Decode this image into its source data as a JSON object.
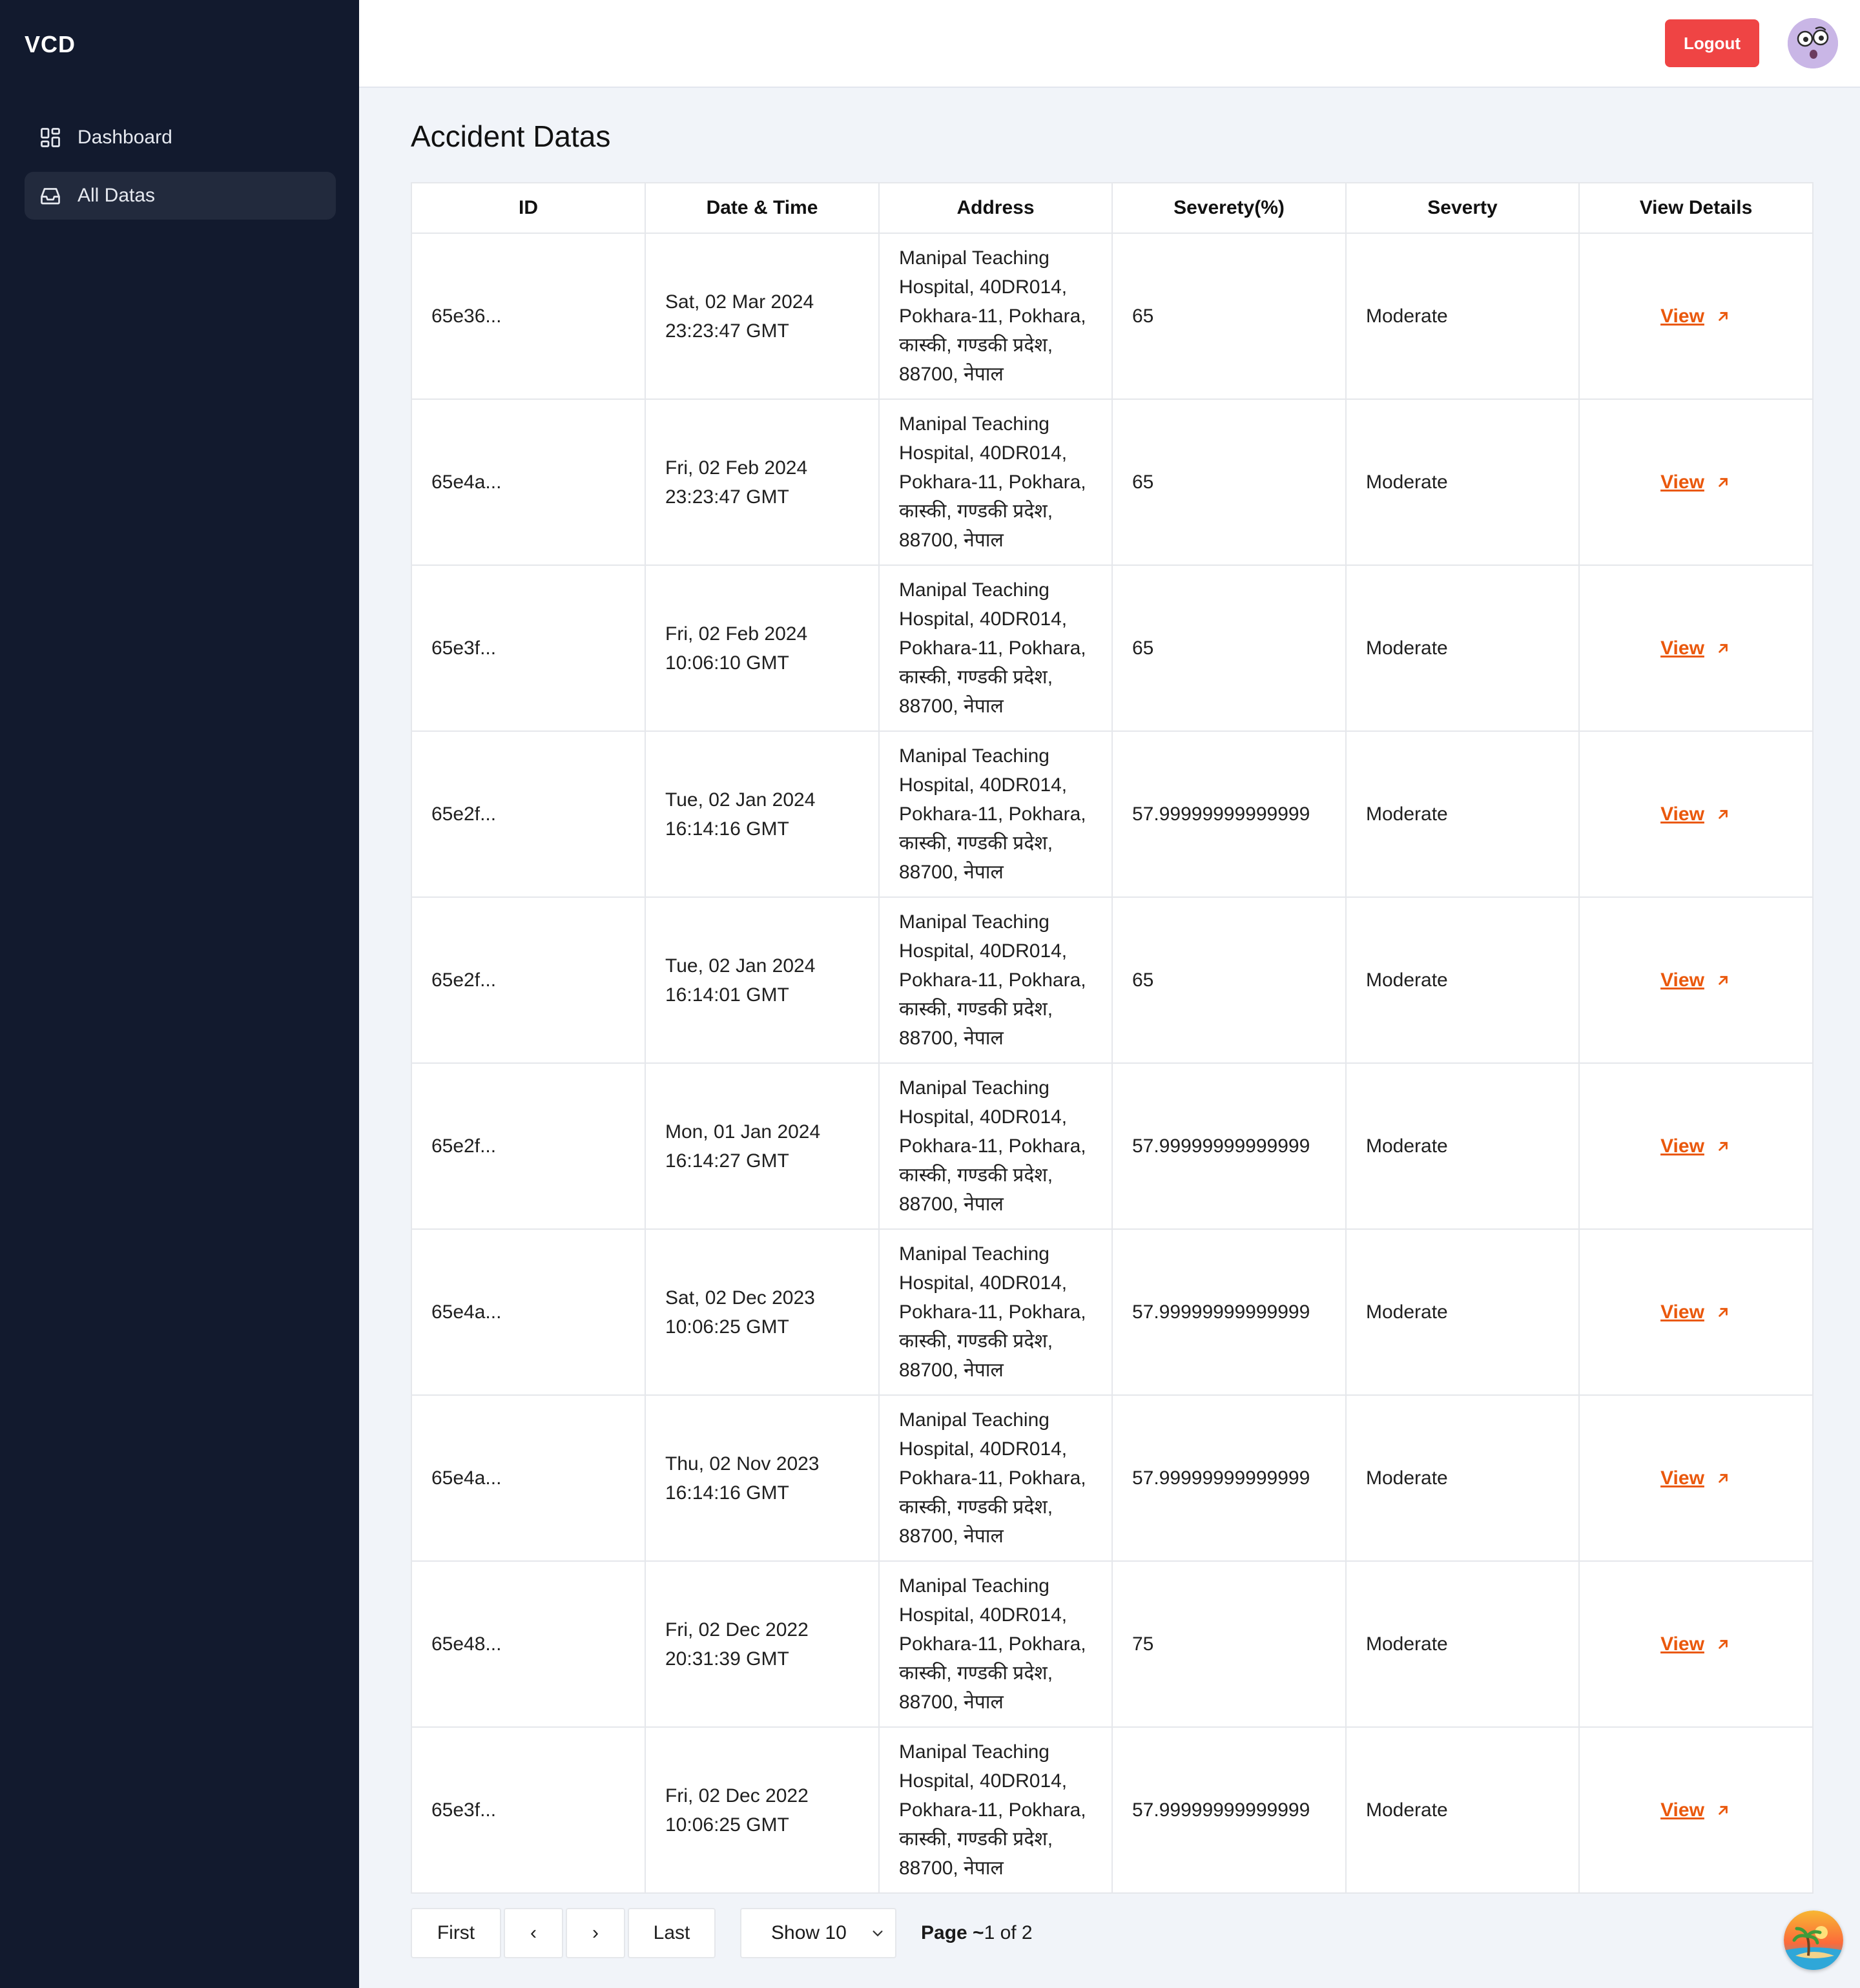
{
  "sidebar": {
    "brand": "VCD",
    "items": [
      {
        "label": "Dashboard",
        "icon": "dashboard-grid-icon",
        "active": false
      },
      {
        "label": "All Datas",
        "icon": "inbox-tray-icon",
        "active": true
      }
    ]
  },
  "topbar": {
    "logout_label": "Logout",
    "avatar_icon": "avatar-face-icon"
  },
  "main": {
    "title": "Accident Datas",
    "columns": [
      "ID",
      "Date & Time",
      "Address",
      "Severety(%)",
      "Severty",
      "View Details"
    ],
    "rows": [
      {
        "id": "65e36...",
        "date": "Sat, 02 Mar 2024",
        "time": "23:23:47 GMT",
        "address": [
          "Manipal Teaching",
          "Hospital, 40DR014,",
          "Pokhara-11, Pokhara,",
          "कास्की, गण्डकी प्रदेश,",
          "88700, नेपाल"
        ],
        "severity_pct": "65",
        "severity": "Moderate",
        "view": "View"
      },
      {
        "id": "65e4a...",
        "date": "Fri, 02 Feb 2024",
        "time": "23:23:47 GMT",
        "address": [
          "Manipal Teaching",
          "Hospital, 40DR014,",
          "Pokhara-11, Pokhara,",
          "कास्की, गण्डकी प्रदेश,",
          "88700, नेपाल"
        ],
        "severity_pct": "65",
        "severity": "Moderate",
        "view": "View"
      },
      {
        "id": "65e3f...",
        "date": "Fri, 02 Feb 2024",
        "time": "10:06:10 GMT",
        "address": [
          "Manipal Teaching",
          "Hospital, 40DR014,",
          "Pokhara-11, Pokhara,",
          "कास्की, गण्डकी प्रदेश,",
          "88700, नेपाल"
        ],
        "severity_pct": "65",
        "severity": "Moderate",
        "view": "View"
      },
      {
        "id": "65e2f...",
        "date": "Tue, 02 Jan 2024",
        "time": "16:14:16 GMT",
        "address": [
          "Manipal Teaching",
          "Hospital, 40DR014,",
          "Pokhara-11, Pokhara,",
          "कास्की, गण्डकी प्रदेश,",
          "88700, नेपाल"
        ],
        "severity_pct": "57.99999999999999",
        "severity": "Moderate",
        "view": "View"
      },
      {
        "id": "65e2f...",
        "date": "Tue, 02 Jan 2024",
        "time": "16:14:01 GMT",
        "address": [
          "Manipal Teaching",
          "Hospital, 40DR014,",
          "Pokhara-11, Pokhara,",
          "कास्की, गण्डकी प्रदेश,",
          "88700, नेपाल"
        ],
        "severity_pct": "65",
        "severity": "Moderate",
        "view": "View"
      },
      {
        "id": "65e2f...",
        "date": "Mon, 01 Jan 2024",
        "time": "16:14:27 GMT",
        "address": [
          "Manipal Teaching",
          "Hospital, 40DR014,",
          "Pokhara-11, Pokhara,",
          "कास्की, गण्डकी प्रदेश,",
          "88700, नेपाल"
        ],
        "severity_pct": "57.99999999999999",
        "severity": "Moderate",
        "view": "View"
      },
      {
        "id": "65e4a...",
        "date": "Sat, 02 Dec 2023",
        "time": "10:06:25 GMT",
        "address": [
          "Manipal Teaching",
          "Hospital, 40DR014,",
          "Pokhara-11, Pokhara,",
          "कास्की, गण्डकी प्रदेश,",
          "88700, नेपाल"
        ],
        "severity_pct": "57.99999999999999",
        "severity": "Moderate",
        "view": "View"
      },
      {
        "id": "65e4a...",
        "date": "Thu, 02 Nov 2023",
        "time": "16:14:16 GMT",
        "address": [
          "Manipal Teaching",
          "Hospital, 40DR014,",
          "Pokhara-11, Pokhara,",
          "कास्की, गण्डकी प्रदेश,",
          "88700, नेपाल"
        ],
        "severity_pct": "57.99999999999999",
        "severity": "Moderate",
        "view": "View"
      },
      {
        "id": "65e48...",
        "date": "Fri, 02 Dec 2022",
        "time": "20:31:39 GMT",
        "address": [
          "Manipal Teaching",
          "Hospital, 40DR014,",
          "Pokhara-11, Pokhara,",
          "कास्की, गण्डकी प्रदेश,",
          "88700, नेपाल"
        ],
        "severity_pct": "75",
        "severity": "Moderate",
        "view": "View"
      },
      {
        "id": "65e3f...",
        "date": "Fri, 02 Dec 2022",
        "time": "10:06:25 GMT",
        "address": [
          "Manipal Teaching",
          "Hospital, 40DR014,",
          "Pokhara-11, Pokhara,",
          "कास्की, गण्डकी प्रदेश,",
          "88700, नेपाल"
        ],
        "severity_pct": "57.99999999999999",
        "severity": "Moderate",
        "view": "View"
      }
    ]
  },
  "pagination": {
    "first_label": "First",
    "prev_label": "‹",
    "next_label": "›",
    "last_label": "Last",
    "show_label": "Show 10",
    "page_prefix": "Page ~",
    "page_value": "1 of 2"
  },
  "colors": {
    "sidebar_bg": "#121a2e",
    "active_item_bg": "#222a3d",
    "logout_bg": "#ef4444",
    "link": "#ea580c",
    "page_bg": "#f1f4f9"
  },
  "icons": {
    "view_arrow": "arrow-up-right-icon",
    "select_chevron": "chevron-down-icon",
    "fab": "beach-island-icon"
  }
}
